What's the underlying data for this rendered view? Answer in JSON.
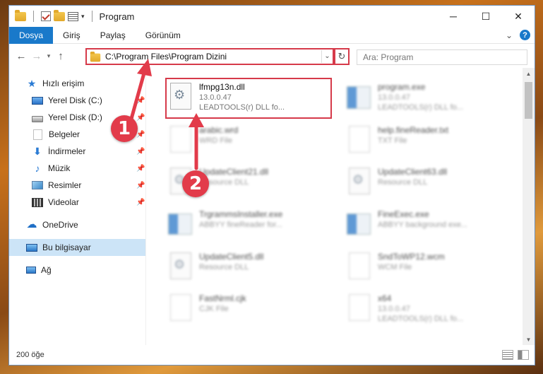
{
  "window": {
    "title": "Program"
  },
  "ribbon": {
    "tabs": [
      "Dosya",
      "Giriş",
      "Paylaş",
      "Görünüm"
    ]
  },
  "nav": {
    "address": "C:\\Program Files\\Program Dizini",
    "search_placeholder": "Ara: Program"
  },
  "sidebar": {
    "quick_access": "Hızlı erişim",
    "items": [
      {
        "label": "Yerel Disk (C:)",
        "icon": "desktop-icon"
      },
      {
        "label": "Yerel Disk (D:)",
        "icon": "disk-icon"
      },
      {
        "label": "Belgeler",
        "icon": "documents-icon"
      },
      {
        "label": "İndirmeler",
        "icon": "downloads-icon"
      },
      {
        "label": "Müzik",
        "icon": "music-icon"
      },
      {
        "label": "Resimler",
        "icon": "pictures-icon"
      },
      {
        "label": "Videolar",
        "icon": "videos-icon"
      }
    ],
    "onedrive": "OneDrive",
    "this_pc": "Bu bilgisayar",
    "network": "Ağ"
  },
  "files": [
    {
      "name": "lfmpg13n.dll",
      "line1": "13.0.0.47",
      "line2": "LEADTOOLS(r) DLL fo...",
      "icon": "dll-icon",
      "blurred": false
    },
    {
      "name": "program.exe",
      "line1": "13.0.0.47",
      "line2": "LEADTOOLS(r) DLL fo...",
      "icon": "exe-icon",
      "blurred": true
    },
    {
      "name": "arabic.wrd",
      "line1": "WRD File",
      "line2": "",
      "icon": "file-icon",
      "blurred": true
    },
    {
      "name": "help.fineReader.txt",
      "line1": "TXT File",
      "line2": "",
      "icon": "file-icon",
      "blurred": true
    },
    {
      "name": "UpdateClient21.dll",
      "line1": "Resource DLL",
      "line2": "",
      "icon": "dll-icon",
      "blurred": true
    },
    {
      "name": "UpdateClient63.dll",
      "line1": "Resource DLL",
      "line2": "",
      "icon": "dll-icon",
      "blurred": true
    },
    {
      "name": "TrgrammsInstaller.exe",
      "line1": "ABBYY fineReader for...",
      "line2": "",
      "icon": "exe-icon",
      "blurred": true
    },
    {
      "name": "FineExec.exe",
      "line1": "ABBYY background exe...",
      "line2": "",
      "icon": "exe-icon",
      "blurred": true
    },
    {
      "name": "UpdateClient5.dll",
      "line1": "Resource DLL",
      "line2": "",
      "icon": "dll-icon",
      "blurred": true
    },
    {
      "name": "SndToWP12.wcm",
      "line1": "WCM File",
      "line2": "",
      "icon": "file-icon",
      "blurred": true
    },
    {
      "name": "FastNrml.cjk",
      "line1": "CJK File",
      "line2": "",
      "icon": "file-icon",
      "blurred": true
    },
    {
      "name": "x64",
      "line1": "13.0.0.47",
      "line2": "LEADTOOLS(r) DLL fo...",
      "icon": "exe-icon",
      "blurred": true
    }
  ],
  "status": {
    "count": "200 öğe"
  },
  "annotations": [
    {
      "label": "1"
    },
    {
      "label": "2"
    }
  ],
  "colors": {
    "accent": "#1979ca",
    "highlight": "#d63a4a",
    "selected": "#cce4f7"
  }
}
